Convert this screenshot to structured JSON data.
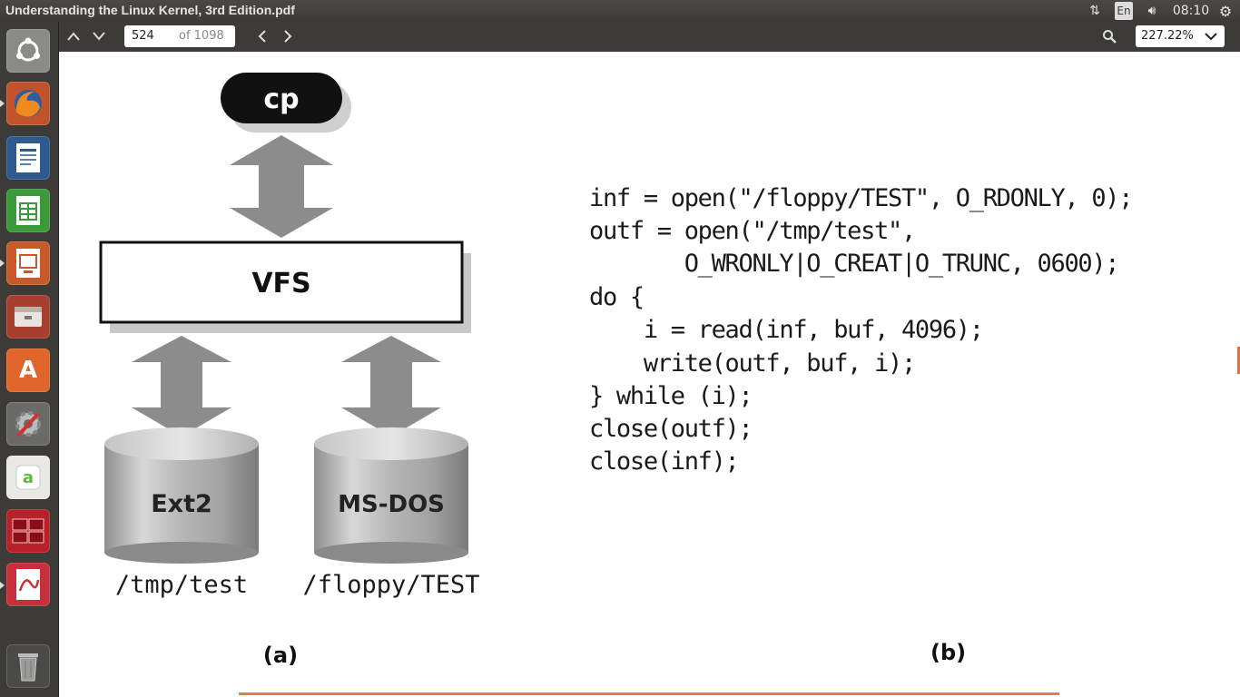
{
  "window": {
    "title": "Understanding the Linux Kernel, 3rd Edition.pdf"
  },
  "indicators": {
    "keyboard": "En",
    "clock": "08:10",
    "network_icon": "arrows-updown-icon",
    "sound_icon": "speaker-icon",
    "settings_icon": "gear-icon"
  },
  "launcher": [
    {
      "name": "dash-icon"
    },
    {
      "name": "firefox-icon"
    },
    {
      "name": "writer-icon"
    },
    {
      "name": "calc-icon"
    },
    {
      "name": "impress-icon"
    },
    {
      "name": "files-icon"
    },
    {
      "name": "software-center-icon"
    },
    {
      "name": "system-settings-icon"
    },
    {
      "name": "app-a-icon"
    },
    {
      "name": "workspace-switcher-icon"
    },
    {
      "name": "document-viewer-icon"
    },
    {
      "name": "trash-icon"
    }
  ],
  "toolbar": {
    "page_current": "524",
    "page_total": "of 1098",
    "zoom": "227.22%"
  },
  "figure": {
    "cp": "cp",
    "vfs": "VFS",
    "disk1": "Ext2",
    "disk2": "MS-DOS",
    "path1": "/tmp/test",
    "path2": "/floppy/TEST",
    "label_a": "(a)",
    "label_b": "(b)",
    "code": [
      "inf = open(\"/floppy/TEST\", O_RDONLY, 0);",
      "outf = open(\"/tmp/test\",",
      "       O_WRONLY|O_CREAT|O_TRUNC, 0600);",
      "do {",
      "    i = read(inf, buf, 4096);",
      "    write(outf, buf, i);",
      "} while (i);",
      "close(outf);",
      "close(inf);"
    ]
  }
}
